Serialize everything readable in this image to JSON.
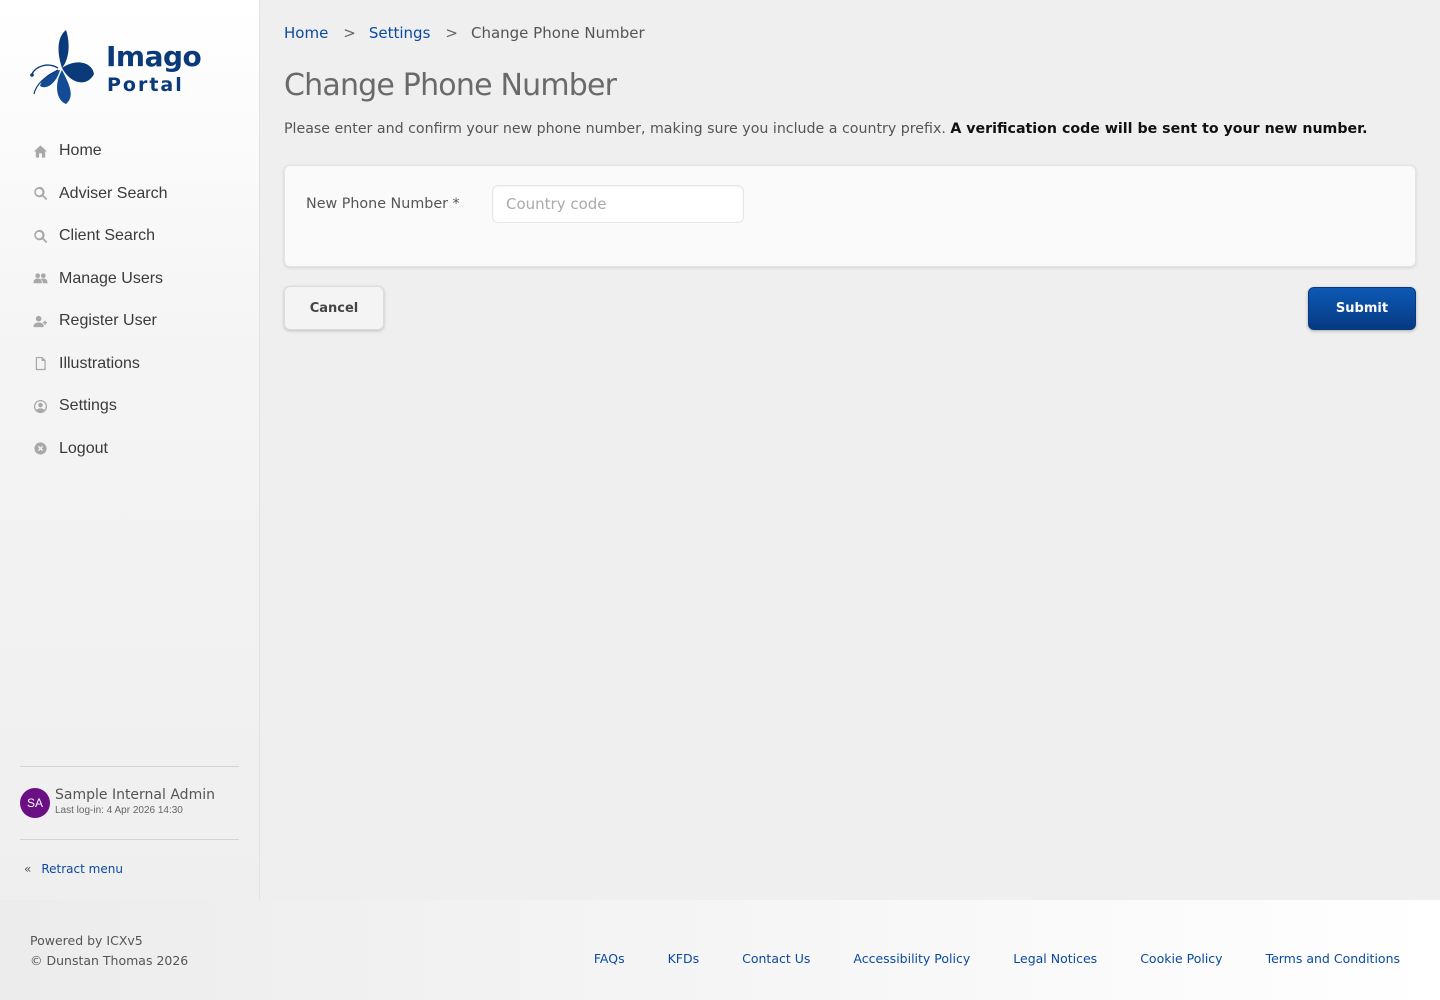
{
  "brand": {
    "line1": "Imago",
    "line2": "Portal",
    "logo_color": "#0b3a7a"
  },
  "sidebar": {
    "items": [
      {
        "label": "Home",
        "icon": "home-icon"
      },
      {
        "label": "Adviser Search",
        "icon": "search-icon"
      },
      {
        "label": "Client Search",
        "icon": "search-icon"
      },
      {
        "label": "Manage Users",
        "icon": "users-icon"
      },
      {
        "label": "Register User",
        "icon": "user-plus-icon"
      },
      {
        "label": "Illustrations",
        "icon": "document-icon"
      },
      {
        "label": "Settings",
        "icon": "user-circle-icon"
      },
      {
        "label": "Logout",
        "icon": "close-circle-icon"
      }
    ],
    "user": {
      "initials": "SA",
      "name": "Sample Internal Admin",
      "last_login": "Last log-in: 4 Apr 2026 14:30",
      "avatar_color": "#6a0f84"
    },
    "retract_label": "Retract menu",
    "retract_icon": "double-chevron-left-icon"
  },
  "breadcrumb": {
    "items": [
      "Home",
      "Settings",
      "Change Phone Number"
    ],
    "separator": ">"
  },
  "page": {
    "title": "Change Phone Number",
    "intro": "Please enter and confirm your new phone number, making sure you include a country prefix.",
    "intro_bold": "A verification code will be sent to your new number."
  },
  "form": {
    "label": "New Phone Number *",
    "country_code_placeholder": "Country code",
    "country_code_value": ""
  },
  "buttons": {
    "cancel": "Cancel",
    "submit": "Submit",
    "submit_color": "#063a83"
  },
  "footer": {
    "powered": "Powered by ICXv5",
    "copyright": "© Dunstan Thomas 2026",
    "links": [
      "FAQs",
      "KFDs",
      "Contact Us",
      "Accessibility Policy",
      "Legal Notices",
      "Cookie Policy",
      "Terms and Conditions"
    ]
  }
}
